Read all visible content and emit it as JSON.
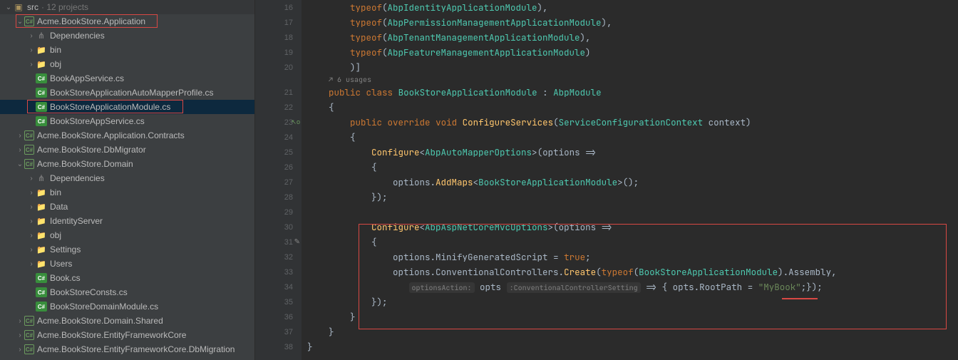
{
  "tree": {
    "root": {
      "label": "src",
      "sub": "· 12 projects"
    },
    "items": [
      {
        "label": "Acme.BookStore.Application",
        "type": "project",
        "indent": 1,
        "arrow": "expanded",
        "red": true
      },
      {
        "label": "Dependencies",
        "type": "dep",
        "indent": 2,
        "arrow": "collapsed"
      },
      {
        "label": "bin",
        "type": "folder",
        "indent": 2,
        "arrow": "collapsed"
      },
      {
        "label": "obj",
        "type": "folder",
        "indent": 2,
        "arrow": "collapsed"
      },
      {
        "label": "BookAppService.cs",
        "type": "cs",
        "indent": 2,
        "arrow": "none"
      },
      {
        "label": "BookStoreApplicationAutoMapperProfile.cs",
        "type": "cs",
        "indent": 2,
        "arrow": "none"
      },
      {
        "label": "BookStoreApplicationModule.cs",
        "type": "cs",
        "indent": 2,
        "arrow": "none",
        "selected": true,
        "red": true
      },
      {
        "label": "BookStoreAppService.cs",
        "type": "cs",
        "indent": 2,
        "arrow": "none"
      },
      {
        "label": "Acme.BookStore.Application.Contracts",
        "type": "project",
        "indent": 1,
        "arrow": "collapsed"
      },
      {
        "label": "Acme.BookStore.DbMigrator",
        "type": "project",
        "indent": 1,
        "arrow": "collapsed"
      },
      {
        "label": "Acme.BookStore.Domain",
        "type": "project",
        "indent": 1,
        "arrow": "expanded"
      },
      {
        "label": "Dependencies",
        "type": "dep",
        "indent": 2,
        "arrow": "collapsed"
      },
      {
        "label": "bin",
        "type": "folder",
        "indent": 2,
        "arrow": "collapsed"
      },
      {
        "label": "Data",
        "type": "folder",
        "indent": 2,
        "arrow": "collapsed"
      },
      {
        "label": "IdentityServer",
        "type": "folder",
        "indent": 2,
        "arrow": "collapsed"
      },
      {
        "label": "obj",
        "type": "folder",
        "indent": 2,
        "arrow": "collapsed"
      },
      {
        "label": "Settings",
        "type": "folder",
        "indent": 2,
        "arrow": "collapsed"
      },
      {
        "label": "Users",
        "type": "folder",
        "indent": 2,
        "arrow": "collapsed"
      },
      {
        "label": "Book.cs",
        "type": "cs",
        "indent": 2,
        "arrow": "none"
      },
      {
        "label": "BookStoreConsts.cs",
        "type": "cs",
        "indent": 2,
        "arrow": "none"
      },
      {
        "label": "BookStoreDomainModule.cs",
        "type": "cs",
        "indent": 2,
        "arrow": "none"
      },
      {
        "label": "Acme.BookStore.Domain.Shared",
        "type": "project",
        "indent": 1,
        "arrow": "collapsed"
      },
      {
        "label": "Acme.BookStore.EntityFrameworkCore",
        "type": "project",
        "indent": 1,
        "arrow": "collapsed"
      },
      {
        "label": "Acme.BookStore.EntityFrameworkCore.DbMigration",
        "type": "project",
        "indent": 1,
        "arrow": "collapsed"
      }
    ]
  },
  "lineNumbers": [
    16,
    17,
    18,
    19,
    20,
    21,
    22,
    23,
    24,
    25,
    26,
    27,
    28,
    29,
    30,
    31,
    32,
    33,
    34,
    35,
    36,
    37,
    38
  ],
  "usagesHint": "6 usages",
  "usagesIcon": "↗",
  "code": {
    "l16_kw": "typeof",
    "l16_type": "AbpIdentityApplicationModule",
    "l17_kw": "typeof",
    "l17_type": "AbpPermissionManagementApplicationModule",
    "l18_kw": "typeof",
    "l18_type": "AbpTenantManagementApplicationModule",
    "l19_kw": "typeof",
    "l19_type": "AbpFeatureManagementApplicationModule",
    "l20_close": ")]",
    "l21_public": "public",
    "l21_class": "class",
    "l21_name": "BookStoreApplicationModule",
    "l21_colon": ":",
    "l21_base": "AbpModule",
    "l22_brace": "{",
    "l23_public": "public",
    "l23_override": "override",
    "l23_void": "void",
    "l23_method": "ConfigureServices",
    "l23_param_type": "ServiceConfigurationContext",
    "l23_param": "context",
    "l24_brace": "{",
    "l25_method": "Configure",
    "l25_type": "AbpAutoMapperOptions",
    "l25_lambda": "(options =>",
    "l26_brace": "{",
    "l27_opts": "options",
    "l27_method": "AddMaps",
    "l27_type": "BookStoreApplicationModule",
    "l28_close": "});",
    "l30_method": "Configure",
    "l30_type": "AbpAspNetCoreMvcOptions",
    "l30_lambda": "(options =>",
    "l31_brace": "{",
    "l32_opts": "options",
    "l32_prop": "MinifyGeneratedScript",
    "l32_val": "true",
    "l33_opts": "options",
    "l33_prop": "ConventionalControllers",
    "l33_method": "Create",
    "l33_kw": "typeof",
    "l33_type": "BookStoreApplicationModule",
    "l33_asm": "Assembly",
    "l34_hint1": "optionsAction:",
    "l34_opts": "opts",
    "l34_hint2": ":ConventionalControllerSetting",
    "l34_arrow": "=>",
    "l34_brace": "{",
    "l34_o": "opts",
    "l34_prop": "RootPath",
    "l34_eq": "=",
    "l34_str": "\"MyBook\"",
    "l34_end": ";});",
    "l35_close": "});",
    "l36_brace": "}",
    "l37_brace": "}",
    "l38_brace": "}"
  }
}
